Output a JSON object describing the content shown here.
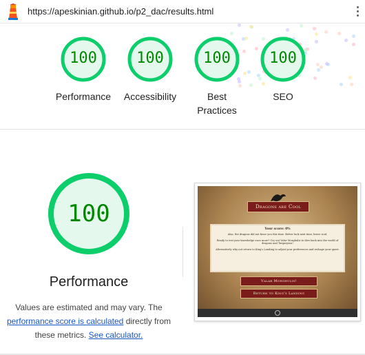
{
  "browser": {
    "url": "https://apeskinian.github.io/p2_dac/results.html"
  },
  "colors": {
    "pass_green": "#0cce6b",
    "pass_text": "#008800",
    "link_blue": "#1a57c8"
  },
  "summary": [
    {
      "score": "100",
      "label": "Performance"
    },
    {
      "score": "100",
      "label": "Accessibility"
    },
    {
      "score": "100",
      "label": "Best Practices"
    },
    {
      "score": "100",
      "label": "SEO"
    }
  ],
  "performance": {
    "score": "100",
    "title": "Performance",
    "note_prefix": "Values are estimated and may vary. The ",
    "note_link1": "performance score is calculated",
    "note_middle": " directly from these metrics. ",
    "note_link2": "See calculator."
  },
  "thumbnail": {
    "banner": "Dragons are Cool",
    "score_title": "Your score: 0%",
    "line1": "Alas, the dragons did not favor you this time. Better luck next time, brave soul.",
    "line2": "Ready to test your knowledge once more? Cry out Valar Morghulis to dive back into the world of dragons and Targaryens!",
    "line3": "Alternatively why not return to King's Landing to adjust your preferences and reshape your quest.",
    "button1": "Valar Morghulis!",
    "button2": "Return to King's Landing"
  }
}
